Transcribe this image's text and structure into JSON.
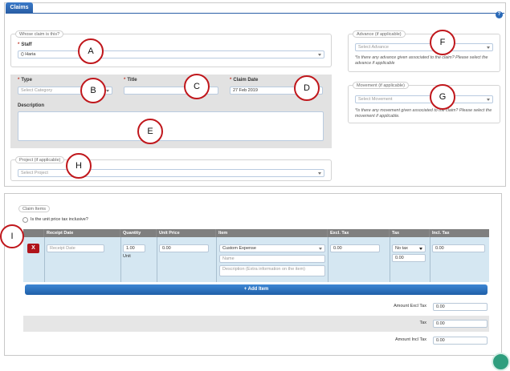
{
  "header": {
    "tab_label": "Claims",
    "help_icon": "?"
  },
  "whose_claim": {
    "legend": "Whose claim is this?",
    "staff_label": "Staff",
    "staff_value": "() Haria"
  },
  "details": {
    "type_label": "Type",
    "type_placeholder": "Select Category",
    "title_label": "Title",
    "title_value": "",
    "claim_date_label": "Claim Date",
    "claim_date_value": "27 Feb 2019",
    "description_label": "Description"
  },
  "project": {
    "legend": "Project (if applicable)",
    "placeholder": "Select Project"
  },
  "advance": {
    "legend": "Advance (if applicable)",
    "placeholder": "Select Advance",
    "hint": "*Is there any advance given associated to the claim? Please select the advance if applicable"
  },
  "movement": {
    "legend": "Movement (if applicable)",
    "placeholder": "Select Movement",
    "hint": "*Is there any movement given associated to the claim? Please select the movement if applicable."
  },
  "markers": [
    "A",
    "B",
    "C",
    "D",
    "E",
    "F",
    "G",
    "H",
    "I"
  ],
  "claim_items": {
    "legend": "Claim Items",
    "tax_inclusive_label": "Is the unit price tax inclusive?",
    "columns": [
      "",
      "Receipt Date",
      "Quantity",
      "Unit Price",
      "Item",
      "Excl. Tax",
      "Tax",
      "Incl. Tax"
    ],
    "row": {
      "delete_label": "X",
      "receipt_date_placeholder": "Receipt Date",
      "quantity": "1.00",
      "unit": "Unit",
      "unit_price": "0.00",
      "item_select": "Custom Expense",
      "item_name_placeholder": "Name",
      "item_description_placeholder": "Description (Extra information on the item)",
      "excl_tax": "0.00",
      "tax_select": "No tax",
      "tax_value": "0.00",
      "incl_tax": "0.00"
    },
    "add_item_label": "+ Add Item",
    "totals": [
      {
        "label": "Amount Excl Tax",
        "value": "0.00"
      },
      {
        "label": "Tax",
        "value": "0.00"
      },
      {
        "label": "Amount Incl Tax",
        "value": "0.00"
      }
    ]
  }
}
